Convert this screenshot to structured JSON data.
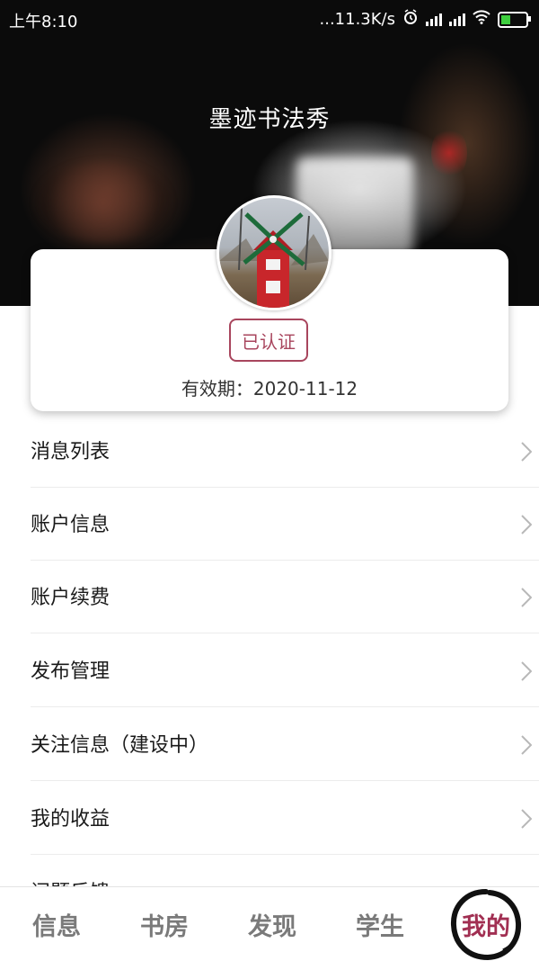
{
  "status_bar": {
    "time": "上午8:10",
    "network_speed": "...11.3K/s",
    "battery_color": "#3ecf3e"
  },
  "header": {
    "title": "墨迹书法秀"
  },
  "profile": {
    "avatar_icon": "windmill-photo",
    "badge": "已认证",
    "validity": "有效期：2020-11-12"
  },
  "menu": {
    "items": [
      {
        "label": "消息列表"
      },
      {
        "label": "账户信息"
      },
      {
        "label": "账户续费"
      },
      {
        "label": "发布管理"
      },
      {
        "label": "关注信息（建设中）"
      },
      {
        "label": "我的收益"
      },
      {
        "label": "问题反馈"
      }
    ]
  },
  "tabbar": {
    "tabs": [
      {
        "label": "信息"
      },
      {
        "label": "书房"
      },
      {
        "label": "发现"
      },
      {
        "label": "学生"
      }
    ],
    "active_label": "我的",
    "active_color": "#a12f52"
  }
}
